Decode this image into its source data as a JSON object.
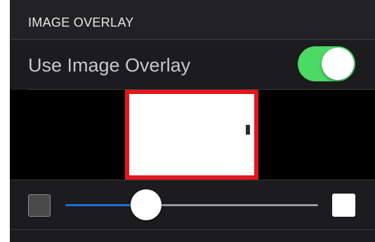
{
  "section": {
    "title": "IMAGE OVERLAY"
  },
  "overlay_toggle": {
    "label": "Use Image Overlay",
    "on": true
  },
  "preview": {
    "frame_color": "#e4161b"
  },
  "opacity_slider": {
    "value_fraction": 0.32,
    "fill_color": "#1e6fd9"
  },
  "colors": {
    "toggle_on": "#4cd964",
    "background": "#1c1c1e"
  },
  "icons": {
    "min": "dark-square-icon",
    "max": "white-square-icon"
  }
}
